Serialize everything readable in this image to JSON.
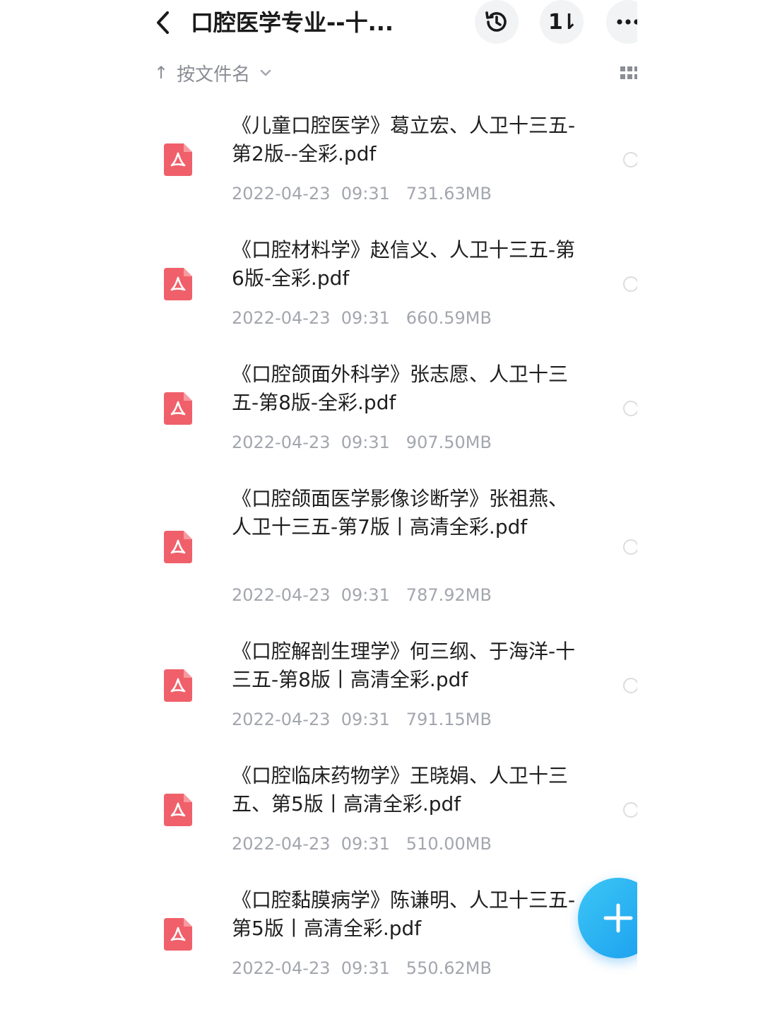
{
  "header": {
    "title": "口腔医学专业--十...",
    "back_icon": "chevron-left-icon",
    "history_icon": "history-icon",
    "sort_icon": "sort-toggle-icon",
    "sort_glyph": "1⇂",
    "more_icon": "more-horizontal-icon"
  },
  "sortbar": {
    "arrow": "↑",
    "label": "按文件名",
    "chevron_icon": "chevron-down-icon",
    "view_icon": "grid-view-icon"
  },
  "colors": {
    "pdf_red": "#f0606a",
    "fab_blue": "#1a9eef",
    "meta_gray": "#a3a6ad"
  },
  "files": [
    {
      "name": "《儿童口腔医学》葛立宏、人卫十三五-第2版--全彩.pdf",
      "date": "2022-04-23  09:31",
      "size": "731.63MB"
    },
    {
      "name": "《口腔材料学》赵信义、人卫十三五-第6版-全彩.pdf",
      "date": "2022-04-23  09:31",
      "size": "660.59MB"
    },
    {
      "name": "《口腔颌面外科学》张志愿、人卫十三五-第8版-全彩.pdf",
      "date": "2022-04-23  09:31",
      "size": "907.50MB"
    },
    {
      "name": "《口腔颌面医学影像诊断学》张祖燕、人卫十三五-第7版丨高清全彩.pdf",
      "date": "2022-04-23  09:31",
      "size": "787.92MB"
    },
    {
      "name": "《口腔解剖生理学》何三纲、于海洋-十三五-第8版丨高清全彩.pdf",
      "date": "2022-04-23  09:31",
      "size": "791.15MB"
    },
    {
      "name": "《口腔临床药物学》王晓娟、人卫十三五、第5版丨高清全彩.pdf",
      "date": "2022-04-23  09:31",
      "size": "510.00MB"
    },
    {
      "name": "《口腔黏膜病学》陈谦明、人卫十三五-第5版丨高清全彩.pdf",
      "date": "2022-04-23  09:31",
      "size": "550.62MB"
    }
  ],
  "fab": {
    "icon": "plus-icon"
  }
}
